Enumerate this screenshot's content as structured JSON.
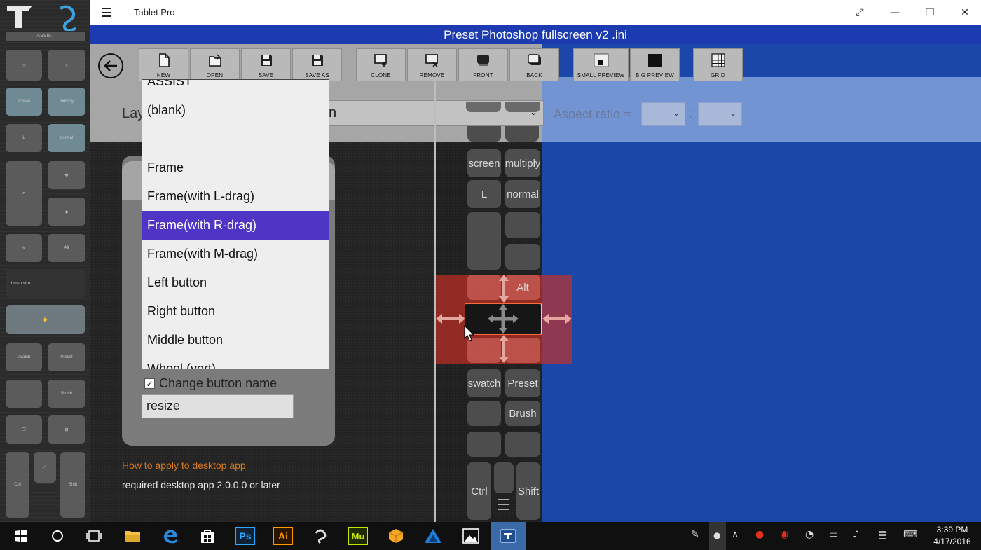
{
  "window": {
    "app_title": "Tablet Pro",
    "file_name": "Preset Photoshop fullscreen v2 .ini"
  },
  "left_strip": {
    "assist_label": "ASSIST",
    "buttons": [
      {
        "label": "screen"
      },
      {
        "label": "multiply"
      },
      {
        "label": "L"
      },
      {
        "label": "normal"
      },
      {
        "label": "Alt"
      },
      {
        "label": "brush size"
      },
      {
        "label": "swatch"
      },
      {
        "label": "Preset"
      },
      {
        "label": "Brush"
      },
      {
        "label": "Ctrl"
      },
      {
        "label": "Shift"
      }
    ]
  },
  "toolbar": {
    "buttons": [
      {
        "label": "NEW",
        "icon": "new-file-icon"
      },
      {
        "label": "OPEN",
        "icon": "open-folder-icon"
      },
      {
        "label": "SAVE",
        "icon": "save-icon"
      },
      {
        "label": "SAVE AS",
        "icon": "save-as-icon"
      },
      {
        "label": "CLONE",
        "icon": "clone-icon"
      },
      {
        "label": "REMOVE",
        "icon": "remove-icon"
      },
      {
        "label": "FRONT",
        "icon": "bring-front-icon"
      },
      {
        "label": "BACK",
        "icon": "send-back-icon"
      },
      {
        "label": "SMALL PREVIEW",
        "icon": "small-preview-icon"
      },
      {
        "label": "BIG PREVIEW",
        "icon": "big-preview-icon"
      },
      {
        "label": "GRID",
        "icon": "grid-icon"
      }
    ]
  },
  "layout": {
    "label_partial": "Lay",
    "combo_value_partial": "n"
  },
  "aspect": {
    "label": "Aspect ratio =",
    "colon": ":",
    "left_value": "",
    "right_value": ""
  },
  "dropdown": {
    "items": [
      "ASSIST",
      "(blank)",
      "",
      "Frame",
      "Frame(with L-drag)",
      "Frame(with R-drag)",
      "Frame(with M-drag)",
      "Left button",
      "Right button",
      "Middle button",
      "Wheel (vert)"
    ],
    "selected": "Frame(with R-drag)"
  },
  "button_editor": {
    "change_name_checked": true,
    "change_name_label": "Change button name",
    "name_value": "resize",
    "help_link": "How to apply to desktop app",
    "requirement": "required desktop app 2.0.0.0 or later"
  },
  "preview": {
    "buttons": [
      {
        "label": "screen"
      },
      {
        "label": "multiply"
      },
      {
        "label": "L"
      },
      {
        "label": "normal"
      },
      {
        "label": "Alt"
      },
      {
        "label": "swatch"
      },
      {
        "label": "Preset"
      },
      {
        "label": "Brush"
      },
      {
        "label": "Ctrl"
      },
      {
        "label": "Shift"
      }
    ]
  },
  "taskbar": {
    "apps": [
      "windows-start-icon",
      "cortana-icon",
      "task-view-icon",
      "file-explorer-icon",
      "edge-icon",
      "store-icon",
      "photoshop-icon",
      "illustrator-icon",
      "clip-studio-icon",
      "muse-icon",
      "package-icon",
      "autodesk-icon",
      "photos-icon",
      "tablet-pro-icon"
    ],
    "ps_label": "Ps",
    "ai_label": "Ai",
    "mu_label": "Mu",
    "time": "3:39 PM",
    "date": "4/17/2016"
  },
  "colors": {
    "accent": "#1c3bb1",
    "selection": "#4e35c6",
    "link": "#d9791e",
    "highlight": "#cc3026"
  }
}
